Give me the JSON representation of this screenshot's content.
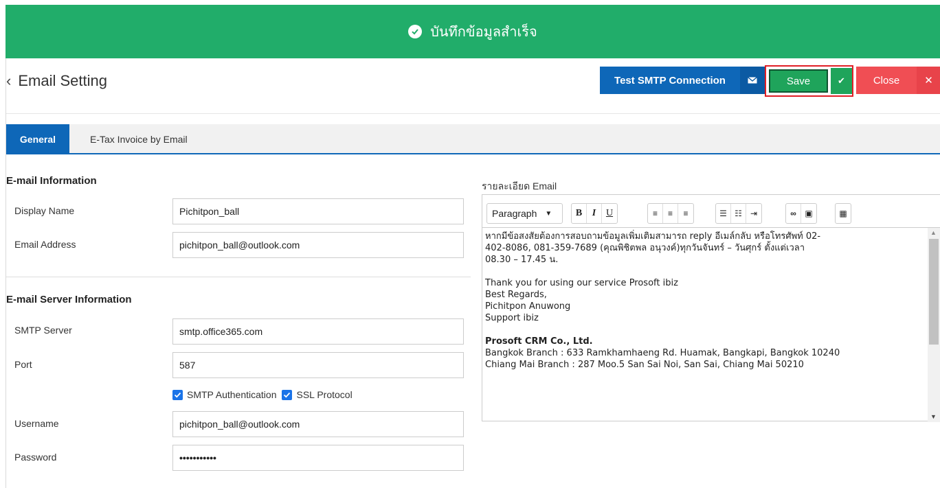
{
  "banner": {
    "message": "บันทึกข้อมูลสำเร็จ"
  },
  "header": {
    "title": "Email Setting",
    "test_smtp_label": "Test SMTP Connection",
    "save_label": "Save",
    "close_label": "Close"
  },
  "tabs": [
    {
      "label": "General"
    },
    {
      "label": "E-Tax Invoice by Email"
    }
  ],
  "email_info": {
    "title": "E-mail Information",
    "display_name_label": "Display Name",
    "display_name_value": "Pichitpon_ball",
    "email_label": "Email Address",
    "email_value": "pichitpon_ball@outlook.com"
  },
  "server_info": {
    "title": "E-mail Server Information",
    "smtp_label": "SMTP Server",
    "smtp_value": "smtp.office365.com",
    "port_label": "Port",
    "port_value": "587",
    "smtp_auth_label": "SMTP Authentication",
    "ssl_label": "SSL Protocol",
    "username_label": "Username",
    "username_value": "pichitpon_ball@outlook.com",
    "password_label": "Password",
    "password_value": "•••••••••••"
  },
  "editor": {
    "label": "รายละเอียด Email",
    "format": "Paragraph",
    "lines": [
      "หากมีข้อสงสัยต้องการสอบถามข้อมูลเพิ่มเติมสามารถ reply อีเมล์กลับ หรือโทรศัพท์ 02-",
      "402-8086, 081-359-7689 (คุณพิชิตพล อนุวงค์)ทุกวันจันทร์ – วันศุกร์ ตั้งแต่เวลา",
      "08.30 – 17.45 น.",
      "Thank you for using our service Prosoft ibiz",
      "Best Regards,",
      "Pichitpon Anuwong",
      "Support ibiz",
      "Prosoft CRM Co., Ltd.",
      "Bangkok Branch : 633 Ramkhamhaeng Rd. Huamak, Bangkapi, Bangkok 10240",
      "Chiang Mai Branch : 287 Moo.5 San Sai Noi, San Sai, Chiang Mai 50210"
    ]
  },
  "icons": [
    "check-circle-icon",
    "chevron-left-icon",
    "envelope-icon",
    "check-icon",
    "close-icon",
    "bold-icon",
    "italic-icon",
    "underline-icon",
    "align-left-icon",
    "align-center-icon",
    "align-right-icon",
    "bullet-list-icon",
    "numbered-list-icon",
    "indent-icon",
    "link-icon",
    "image-icon",
    "table-icon"
  ],
  "colors": {
    "banner": "#21ad6a",
    "primary": "#0e67b8",
    "save": "#1fa45b",
    "close": "#f04e54",
    "highlight": "#e01e25"
  }
}
